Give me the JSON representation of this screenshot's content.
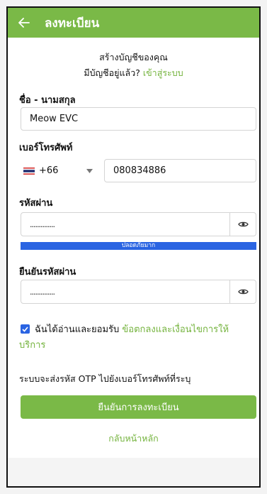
{
  "header": {
    "title": "ลงทะเบียน",
    "back_icon": "arrow-left-icon"
  },
  "intro": {
    "create_text": "สร้างบัญชีของคุณ",
    "have_account_text": "มีบัญชีอยู่แล้ว?",
    "login_link": "เข้าสู่ระบบ"
  },
  "form": {
    "name_label": "ชื่อ - นามสกุล",
    "name_value": "Meow EVC",
    "phone_label": "เบอร์โทรศัพท์",
    "country_code": "+66",
    "phone_value": "080834886",
    "password_label": "รหัสผ่าน",
    "password_value": "..............",
    "strength_text": "ปลอดภัยมาก",
    "confirm_label": "ยืนยันรหัสผ่าน",
    "confirm_value": "..............",
    "consent_text": "ฉันได้อ่านและยอมรับ",
    "terms_link_1": "ข้อตกลงและเงื่อนไขการให้",
    "terms_link_2": "บริการ",
    "otp_note": "ระบบจะส่งรหัส OTP ไปยังเบอร์โทรศัพท์ที่ระบุ",
    "submit_label": "ยืนยันการลงทะเบียน",
    "home_link": "กลับหน้าหลัก"
  },
  "colors": {
    "brand_green": "#7ab947",
    "link_green": "#74b33d",
    "strength_blue": "#2a64e2"
  }
}
